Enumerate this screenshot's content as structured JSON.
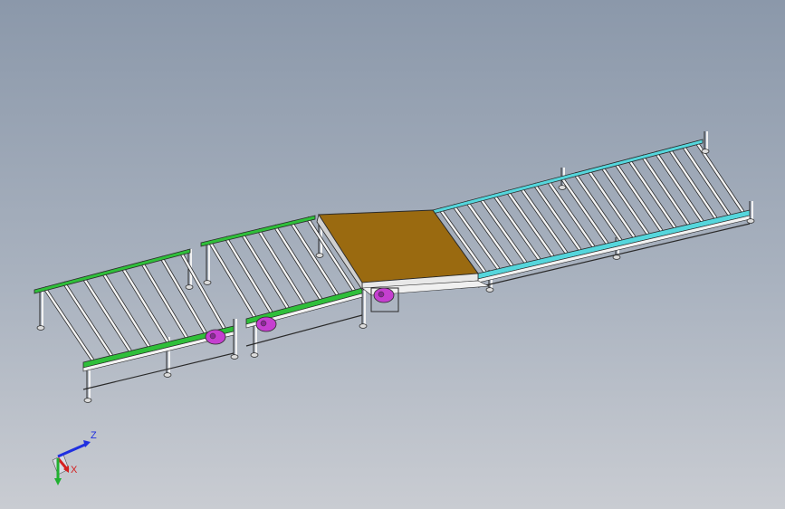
{
  "viewport": {
    "background_top": "#8b98aa",
    "background_bottom": "#c9ccd2"
  },
  "model": {
    "sections": [
      {
        "name": "roller-conveyor-left",
        "rail_color": "#2fbf3a",
        "roller_count": 8
      },
      {
        "name": "roller-conveyor-middle",
        "rail_color": "#2fbf3a",
        "roller_count": 7
      },
      {
        "name": "transfer-table",
        "surface_color": "#9a6a10"
      },
      {
        "name": "roller-conveyor-right",
        "rail_color": "#55d6dc",
        "roller_count": 20
      }
    ],
    "motor_color": "#c53fd0",
    "frame_color": "#f2f2f2",
    "edge_color": "#2a2a2a"
  },
  "triad": {
    "z_label": "Z",
    "x_label": "X",
    "z_color": "#1f2fe0",
    "x_color": "#d42020",
    "y_color": "#20b030"
  }
}
